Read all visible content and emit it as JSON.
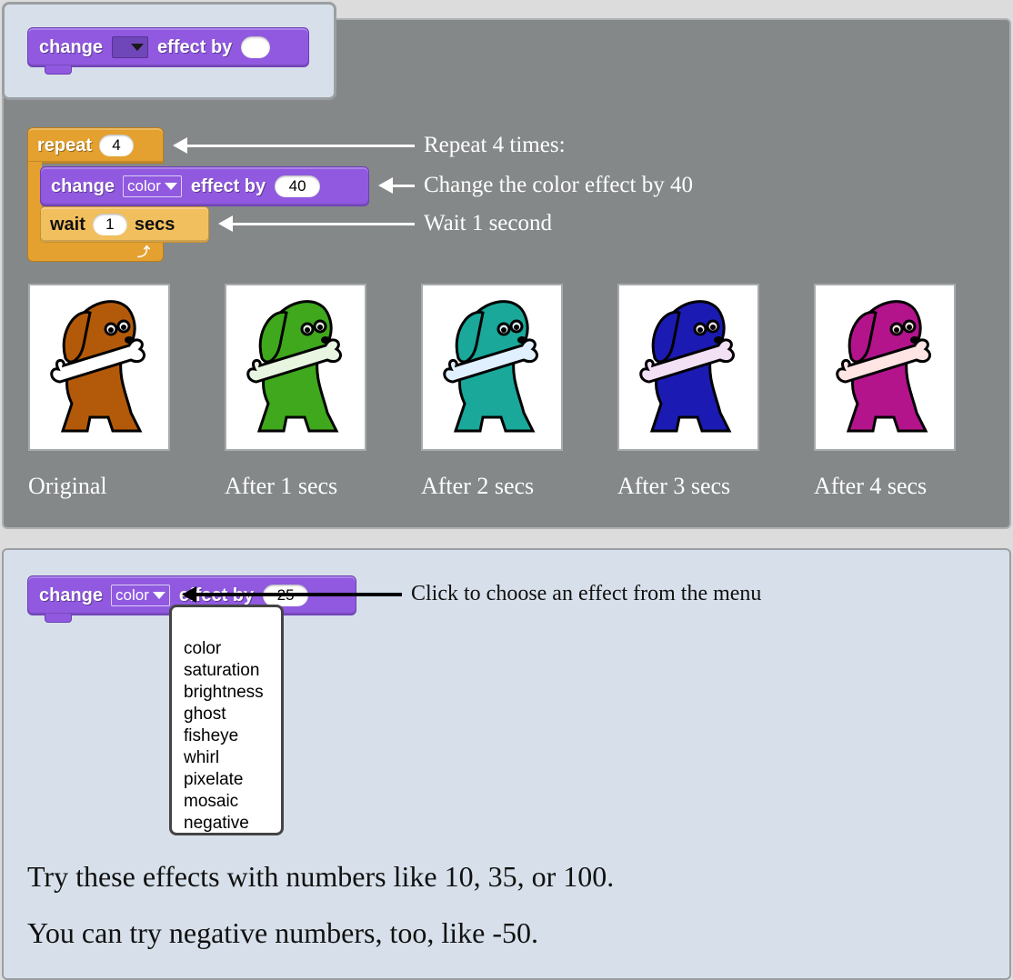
{
  "top_block": {
    "change": "change",
    "effect_by": "effect by"
  },
  "script": {
    "repeat": "repeat",
    "repeat_count": "4",
    "change": "change",
    "effect_name": "color",
    "effect_by": "effect by",
    "effect_amount": "40",
    "wait": "wait",
    "wait_amount": "1",
    "secs": "secs"
  },
  "annotations": {
    "repeat_note": "Repeat 4 times:",
    "change_note": "Change the color effect by 40",
    "wait_note": "Wait 1 second"
  },
  "images": [
    {
      "caption": "Original",
      "color": "#b35a0a"
    },
    {
      "caption": "After 1 secs",
      "color": "#3fa81c"
    },
    {
      "caption": "After 2 secs",
      "color": "#19a89a"
    },
    {
      "caption": "After 3 secs",
      "color": "#1b1bb3"
    },
    {
      "caption": "After 4 secs",
      "color": "#b3148c"
    }
  ],
  "menu_block": {
    "change": "change",
    "effect_name": "color",
    "effect_by": "effect by",
    "effect_amount": "25",
    "note": "Click to choose an effect from the menu"
  },
  "menu": {
    "items": [
      "color",
      "saturation",
      "brightness",
      "ghost",
      "fisheye",
      "whirl",
      "pixelate",
      "mosaic",
      "negative"
    ]
  },
  "text": {
    "line1": "Try these effects with numbers like 10, 35, or 100.",
    "line2": "You can try negative numbers, too, like -50."
  }
}
